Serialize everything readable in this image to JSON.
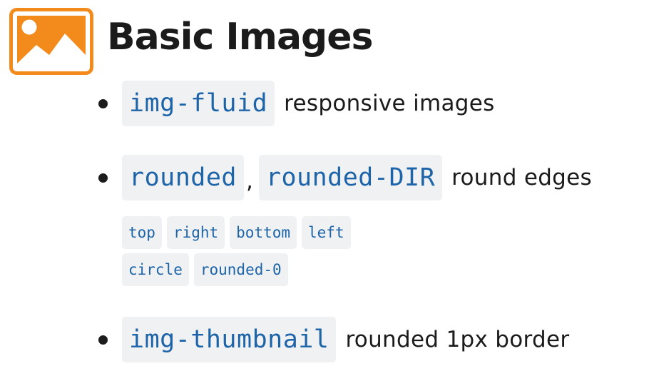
{
  "header": {
    "title": "Basic Images",
    "icon": "image-icon",
    "icon_color": "#f28b1c"
  },
  "items": [
    {
      "codes": [
        "img-fluid"
      ],
      "description": "responsive images"
    },
    {
      "codes": [
        "rounded",
        "rounded-DIR"
      ],
      "separator": ",",
      "description": "round edges",
      "directions": [
        [
          "top",
          "right",
          "bottom",
          "left"
        ],
        [
          "circle",
          "rounded-0"
        ]
      ]
    },
    {
      "codes": [
        "img-thumbnail"
      ],
      "description": "rounded 1px border"
    }
  ],
  "colors": {
    "code_text": "#1d64a8",
    "code_background": "#f0f1f3",
    "text": "#1b1b1b"
  }
}
